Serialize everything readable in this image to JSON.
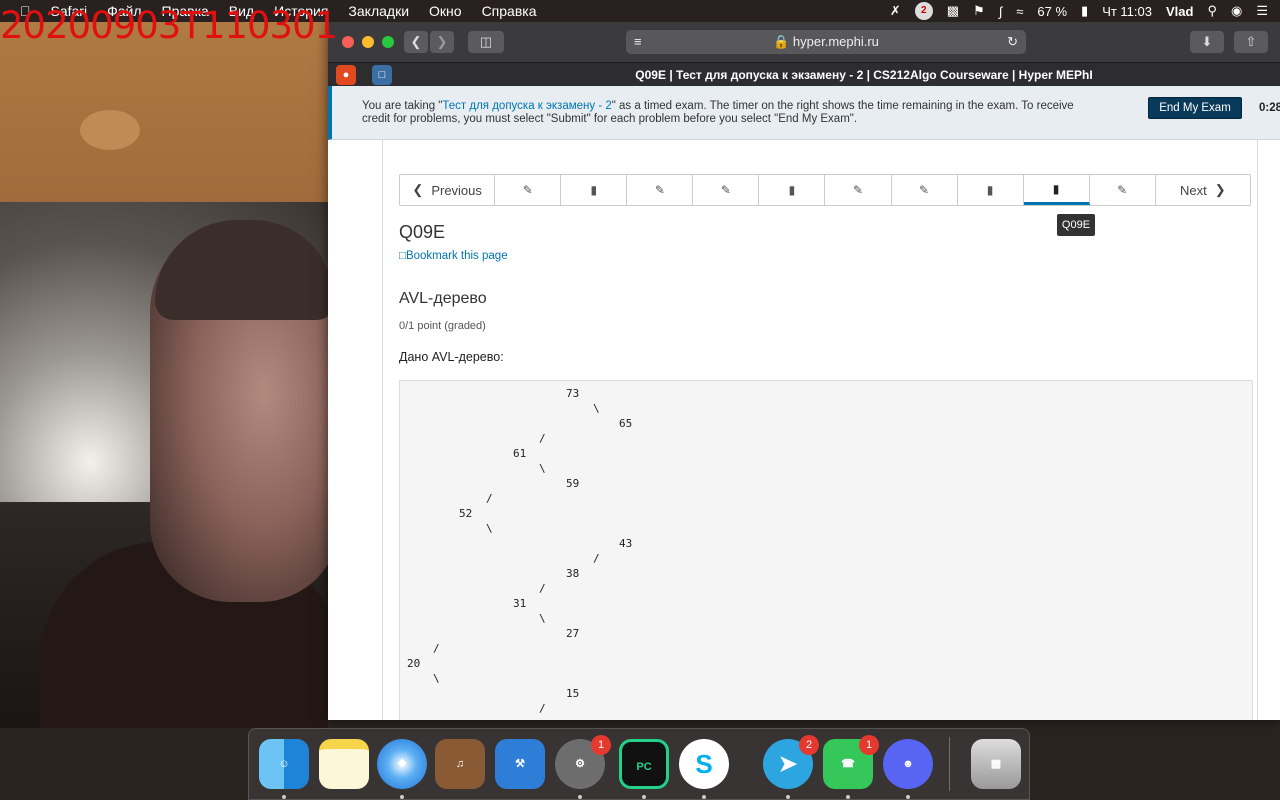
{
  "timestamp": "20200903T110301",
  "menubar": {
    "items": [
      "Safari",
      "Файл",
      "Правка",
      "Вид",
      "История",
      "Закладки",
      "Окно",
      "Справка"
    ],
    "battery": "67 %",
    "clock": "Чт 11:03",
    "user": "Vlad",
    "notif_badge": "2"
  },
  "browser": {
    "address": "hyper.mephi.ru",
    "tab_title": "Q09E | Тест для допуска к экзамену - 2 | CS212Algo Courseware | Hyper MEPhI"
  },
  "banner": {
    "text_before": "You are taking \"",
    "exam_link": "Тест для допуска к экзамену - 2",
    "text_after": "\" as a timed exam. The timer on the right shows the time remaining in the exam. To receive credit for problems, you must select \"Submit\" for each problem before you select \"End My Exam\".",
    "end_button": "End My Exam",
    "timer": "0:28:"
  },
  "seqnav": {
    "prev": "Previous",
    "next": "Next",
    "tooltip": "Q09E"
  },
  "unit": {
    "title": "Q09E",
    "bookmark": "Bookmark this page",
    "problem_title": "AVL-дерево",
    "points": "0/1 point (graded)",
    "given": "Дано AVL-дерево:"
  },
  "tree_lines": [
    "73",
    "\\",
    "65",
    "/",
    "61",
    "\\",
    "59",
    "/",
    "52",
    "\\",
    "43",
    "/",
    "38",
    "/",
    "31",
    "\\",
    "27",
    "/",
    "20",
    "\\",
    "15",
    "/"
  ],
  "dock": {
    "badges": {
      "syspref": "1",
      "telegram": "2",
      "facetime": "1"
    }
  }
}
